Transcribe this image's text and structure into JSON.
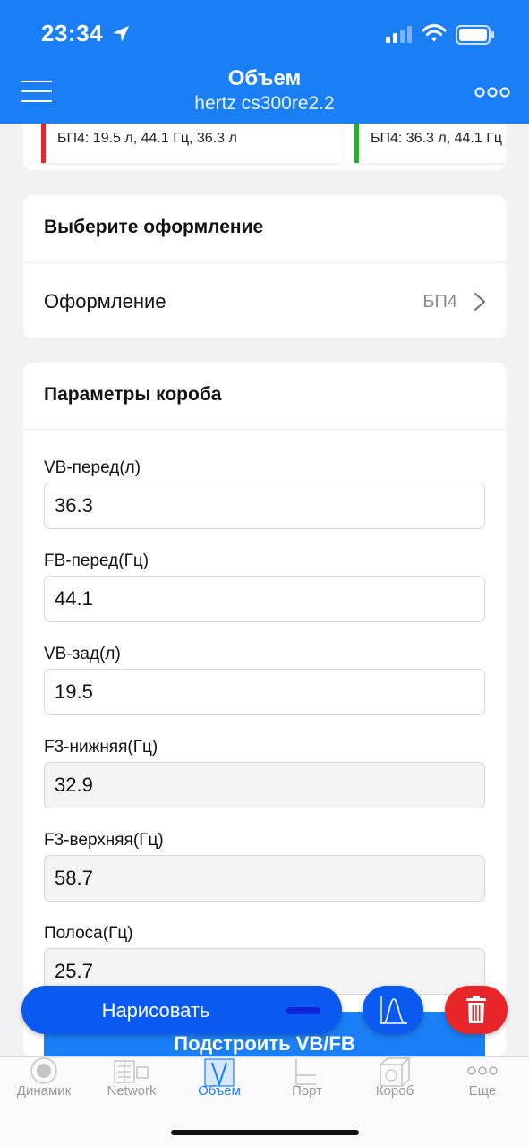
{
  "status_bar": {
    "time": "23:34"
  },
  "header": {
    "title": "Объем",
    "subtitle": "hertz cs300re2.2"
  },
  "results": [
    {
      "text": "БП4: 19.5 л, 44.1 Гц, 36.3 л",
      "color": "#e8262a"
    },
    {
      "text": "БП4: 36.3 л, 44.1 Гц",
      "color": "#22b02e"
    }
  ],
  "design_card": {
    "title": "Выберите оформление",
    "row_label": "Оформление",
    "row_value": "БП4"
  },
  "params_card": {
    "title": "Параметры короба",
    "fields": [
      {
        "label": "VB-перед(л)",
        "value": "36.3"
      },
      {
        "label": "FB-перед(Гц)",
        "value": "44.1"
      },
      {
        "label": "VB-зад(л)",
        "value": "19.5"
      },
      {
        "label": "F3-нижняя(Гц)",
        "value": "32.9"
      },
      {
        "label": "F3-верхняя(Гц)",
        "value": "58.7"
      },
      {
        "label": "Полоса(Гц)",
        "value": "25.7"
      }
    ]
  },
  "actions": {
    "calc_label": "Подстроить VB/FB",
    "draw_label": "Нарисовать"
  },
  "tabs": [
    {
      "label": "Динамик",
      "icon": "speaker-icon"
    },
    {
      "label": "Network",
      "icon": "network-icon"
    },
    {
      "label": "Объем",
      "icon": "volume-icon",
      "active": true
    },
    {
      "label": "Порт",
      "icon": "port-icon"
    },
    {
      "label": "Короб",
      "icon": "box-icon"
    },
    {
      "label": "Еще",
      "icon": "more-icon"
    }
  ],
  "colors": {
    "accent": "#1a7ff5",
    "delete": "#e8262a",
    "background": "#f2f2f5"
  }
}
